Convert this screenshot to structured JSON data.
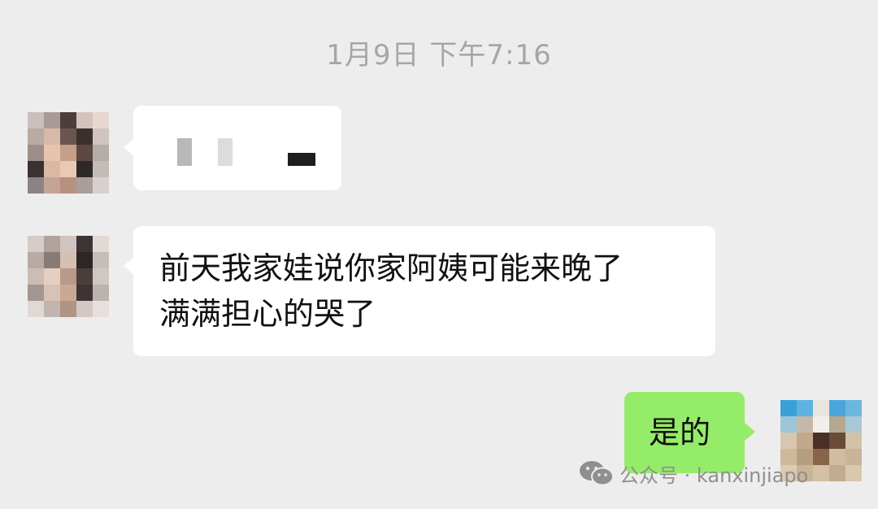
{
  "chat": {
    "timestamp": "1月9日 下午7:16",
    "messages": [
      {
        "side": "left",
        "type": "pixelated",
        "text": ""
      },
      {
        "side": "left",
        "type": "text",
        "lines": [
          "前天我家娃说你家阿姨可能来晚了",
          "满满担心的哭了"
        ]
      },
      {
        "side": "right",
        "type": "text",
        "lines": [
          "是的"
        ]
      }
    ]
  },
  "watermark": {
    "icon": "wechat-icon",
    "text": "公众号 · kanxinjiapo"
  },
  "colors": {
    "background": "#ededed",
    "incoming_bubble": "#ffffff",
    "outgoing_bubble": "#95ec69",
    "timestamp_text": "#a6a6a6"
  }
}
